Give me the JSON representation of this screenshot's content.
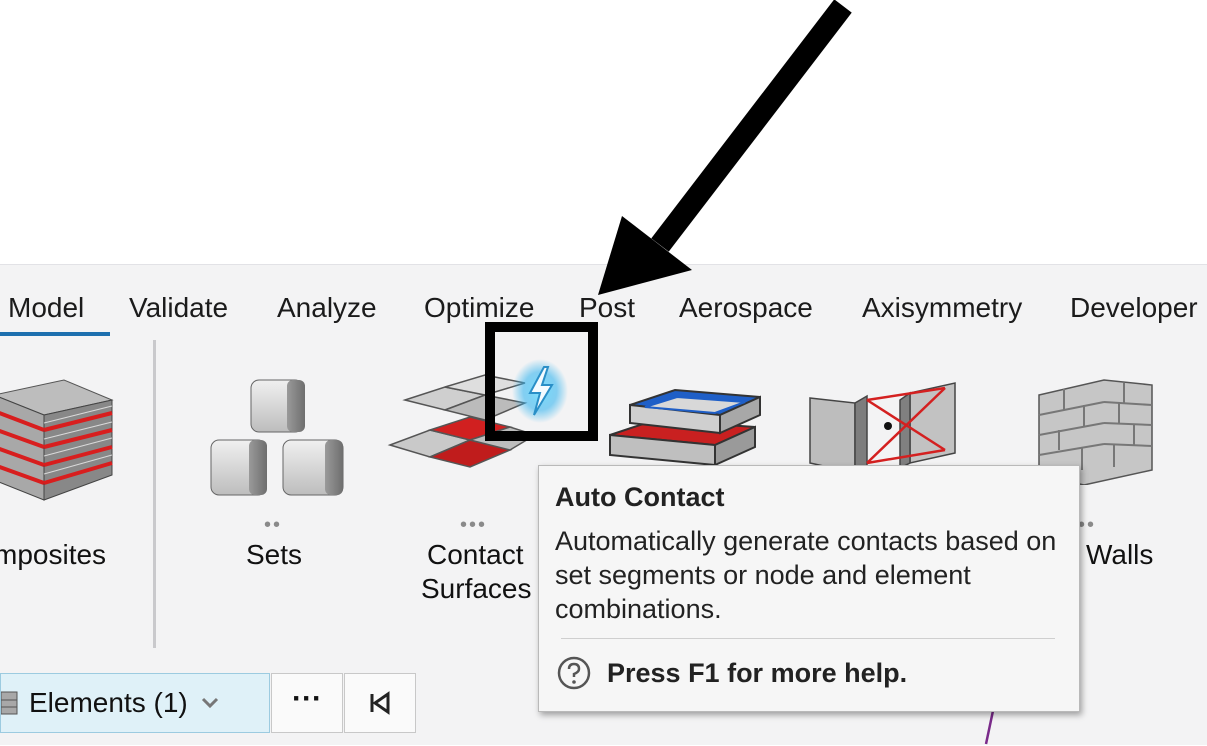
{
  "ribbon": {
    "tabs": [
      {
        "label": "Model"
      },
      {
        "label": "Validate"
      },
      {
        "label": "Analyze"
      },
      {
        "label": "Optimize"
      },
      {
        "label": "Post"
      },
      {
        "label": "Aerospace"
      },
      {
        "label": "Axisymmetry"
      },
      {
        "label": "Developer"
      }
    ],
    "active_tab": "Model",
    "accent_color": "#1d6fae",
    "tools": {
      "composites_label": "mposites",
      "sets_label": "Sets",
      "contact_label_line1": "Contact",
      "contact_label_line2": "Surfaces",
      "walls_label": "l Walls",
      "more_dots": "•••",
      "sets_dots": "••"
    }
  },
  "bottom_bar": {
    "elements_label": "Elements (1)",
    "more_label": "···"
  },
  "tooltip": {
    "title": "Auto Contact",
    "description": "Automatically generate contacts based on set segments or node and element combinations.",
    "help_text": "Press F1 for more help."
  },
  "icons": [
    "composites-icon",
    "sets-icon",
    "contact-surfaces-icon",
    "auto-contact-icon",
    "groups-icon",
    "rigid-link-icon",
    "rigid-walls-icon",
    "elements-icon",
    "chevron-down-icon",
    "more-icon",
    "first-page-icon",
    "help-icon"
  ]
}
